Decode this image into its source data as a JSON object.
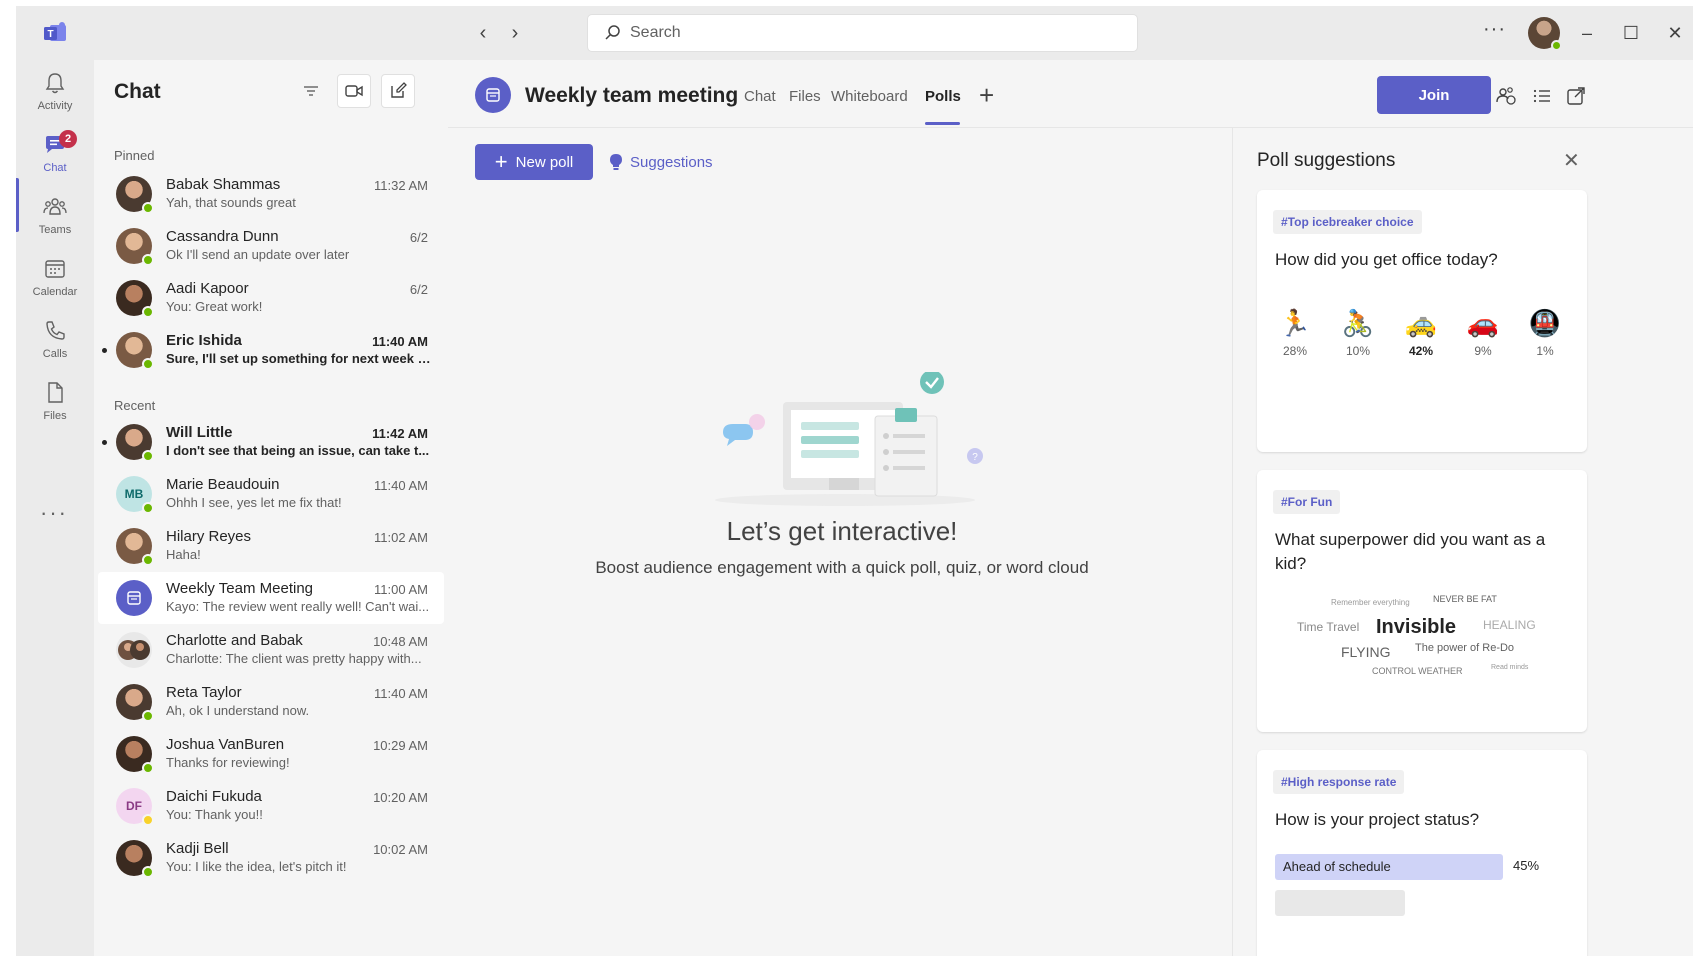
{
  "titlebar": {
    "search_placeholder": "Search",
    "more": "···"
  },
  "rail": {
    "items": [
      {
        "label": "Activity",
        "icon": "bell-icon"
      },
      {
        "label": "Chat",
        "icon": "chat-icon",
        "badge": "2"
      },
      {
        "label": "Teams",
        "icon": "teams-icon"
      },
      {
        "label": "Calendar",
        "icon": "calendar-icon"
      },
      {
        "label": "Calls",
        "icon": "phone-icon"
      },
      {
        "label": "Files",
        "icon": "file-icon"
      }
    ],
    "more": "···"
  },
  "chatlist": {
    "title": "Chat",
    "pinned_label": "Pinned",
    "recent_label": "Recent",
    "pinned": [
      {
        "name": "Babak Shammas",
        "time": "11:32 AM",
        "preview": "Yah, that sounds great",
        "unread": false
      },
      {
        "name": "Cassandra Dunn",
        "time": "6/2",
        "preview": "Ok I'll send an update over later",
        "unread": false
      },
      {
        "name": "Aadi Kapoor",
        "time": "6/2",
        "preview": "You: Great work!",
        "unread": false
      },
      {
        "name": "Eric Ishida",
        "time": "11:40 AM",
        "preview": "Sure, I'll set up something for next week to...",
        "unread": true
      }
    ],
    "recent": [
      {
        "name": "Will Little",
        "time": "11:42 AM",
        "preview": "I don't see that being an issue, can take t...",
        "unread": true
      },
      {
        "name": "Marie Beaudouin",
        "initials": "MB",
        "time": "11:40 AM",
        "preview": "Ohhh I see, yes let me fix that!",
        "unread": false
      },
      {
        "name": "Hilary Reyes",
        "time": "11:02 AM",
        "preview": "Haha!",
        "unread": false
      },
      {
        "name": "Weekly Team Meeting",
        "time": "11:00 AM",
        "preview": "Kayo: The review went really well! Can't wai...",
        "unread": false
      },
      {
        "name": "Charlotte and Babak",
        "time": "10:48 AM",
        "preview": "Charlotte: The client was pretty happy with...",
        "unread": false
      },
      {
        "name": "Reta Taylor",
        "time": "11:40 AM",
        "preview": "Ah, ok I understand now.",
        "unread": false
      },
      {
        "name": "Joshua VanBuren",
        "time": "10:29 AM",
        "preview": "Thanks for reviewing!",
        "unread": false
      },
      {
        "name": "Daichi Fukuda",
        "initials": "DF",
        "time": "10:20 AM",
        "preview": "You: Thank you!!",
        "unread": false
      },
      {
        "name": "Kadji Bell",
        "time": "10:02 AM",
        "preview": "You: I like the idea, let's pitch it!",
        "unread": false
      }
    ]
  },
  "meeting": {
    "title": "Weekly team meeting",
    "tabs": [
      "Chat",
      "Files",
      "Whiteboard",
      "Polls"
    ],
    "active_tab": "Polls",
    "join_label": "Join"
  },
  "polls": {
    "new_poll_label": "New poll",
    "suggestions_label": "Suggestions",
    "empty_title": "Let’s get interactive!",
    "empty_subtitle": "Boost audience engagement with a quick poll, quiz, or word cloud"
  },
  "suggestions": {
    "title": "Poll suggestions",
    "cards": [
      {
        "tag": "#Top icebreaker choice",
        "question": "How did you get office today?",
        "options": [
          {
            "emoji": "🏃",
            "pct": "28%"
          },
          {
            "emoji": "🚴",
            "pct": "10%"
          },
          {
            "emoji": "🚕",
            "pct": "42%"
          },
          {
            "emoji": "🚗",
            "pct": "9%"
          },
          {
            "emoji": "🚇",
            "pct": "1%"
          }
        ]
      },
      {
        "tag": "#For Fun",
        "question": "What superpower did you want as a kid?",
        "words": [
          "Remember everything",
          "NEVER BE FAT",
          "Time Travel",
          "Invisible",
          "HEALING",
          "FLYING",
          "The power of Re-Do",
          "CONTROL WEATHER",
          "Read minds"
        ]
      },
      {
        "tag": "#High response rate",
        "question": "How is your project status?",
        "bar_label": "Ahead of schedule",
        "bar_pct": "45%"
      }
    ]
  },
  "colors": {
    "brand": "#5b5fc7",
    "presence_available": "#6bb700",
    "presence_away": "#f8d22a",
    "badge": "#c4314b"
  }
}
